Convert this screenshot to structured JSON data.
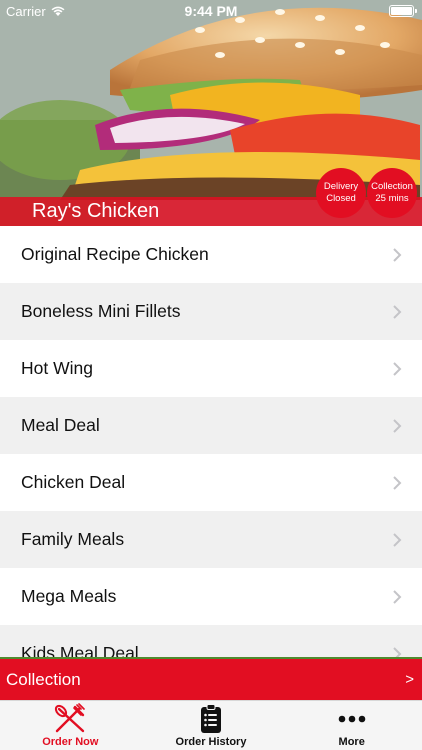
{
  "status_bar": {
    "carrier": "Carrier",
    "time": "9:44 PM"
  },
  "hero": {
    "restaurant_name": "Ray's Chicken",
    "delivery_badge": {
      "line1": "Delivery",
      "line2": "Closed"
    },
    "collection_badge": {
      "line1": "Collection",
      "line2": "25 mins"
    }
  },
  "menu": {
    "items": [
      {
        "label": "Original Recipe Chicken"
      },
      {
        "label": "Boneless Mini Fillets"
      },
      {
        "label": "Hot Wing"
      },
      {
        "label": "Meal Deal"
      },
      {
        "label": "Chicken Deal"
      },
      {
        "label": "Family Meals"
      },
      {
        "label": "Mega Meals"
      },
      {
        "label": "Kids Meal Deal"
      }
    ]
  },
  "collection_bar": {
    "label": "Collection",
    "arrow": ">"
  },
  "tabs": [
    {
      "label": "Order Now",
      "icon": "fork-knife-icon",
      "active": true
    },
    {
      "label": "Order History",
      "icon": "clipboard-list-icon",
      "active": false
    },
    {
      "label": "More",
      "icon": "more-dots-icon",
      "active": false
    }
  ],
  "colors": {
    "brand_red": "#e20e22",
    "row_alt": "#f0f0f0",
    "accent_green": "#4f8a2e"
  }
}
